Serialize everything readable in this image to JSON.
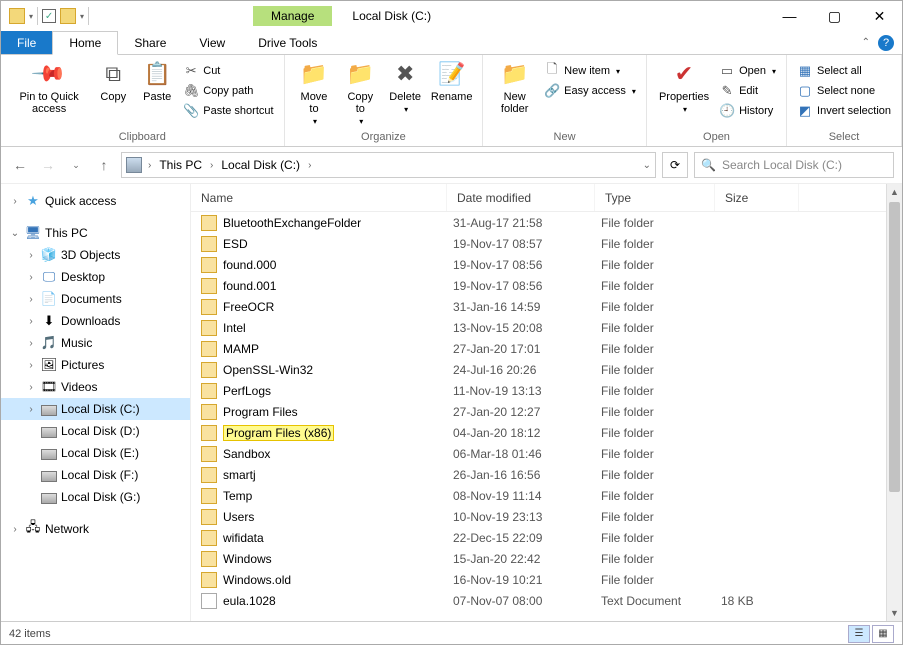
{
  "window": {
    "manage": "Manage",
    "title": "Local Disk (C:)"
  },
  "tabs": {
    "file": "File",
    "home": "Home",
    "share": "Share",
    "view": "View",
    "drive_tools": "Drive Tools"
  },
  "ribbon": {
    "pin": "Pin to Quick access",
    "copy": "Copy",
    "paste": "Paste",
    "cut": "Cut",
    "copy_path": "Copy path",
    "paste_shortcut": "Paste shortcut",
    "clipboard": "Clipboard",
    "move_to": "Move to",
    "copy_to": "Copy to",
    "delete": "Delete",
    "rename": "Rename",
    "organize": "Organize",
    "new_folder": "New folder",
    "new_item": "New item",
    "easy_access": "Easy access",
    "new": "New",
    "properties": "Properties",
    "open": "Open",
    "edit": "Edit",
    "history": "History",
    "open_group": "Open",
    "select_all": "Select all",
    "select_none": "Select none",
    "invert": "Invert selection",
    "select": "Select"
  },
  "address": {
    "this_pc": "This PC",
    "location": "Local Disk (C:)"
  },
  "search_placeholder": "Search Local Disk (C:)",
  "nav": {
    "quick_access": "Quick access",
    "this_pc": "This PC",
    "objects3d": "3D Objects",
    "desktop": "Desktop",
    "documents": "Documents",
    "downloads": "Downloads",
    "music": "Music",
    "pictures": "Pictures",
    "videos": "Videos",
    "disk_c": "Local Disk (C:)",
    "disk_d": "Local Disk (D:)",
    "disk_e": "Local Disk (E:)",
    "disk_f": "Local Disk (F:)",
    "disk_g": "Local Disk (G:)",
    "network": "Network"
  },
  "columns": {
    "name": "Name",
    "date": "Date modified",
    "type": "Type",
    "size": "Size"
  },
  "files": [
    {
      "name": "BluetoothExchangeFolder",
      "date": "31-Aug-17 21:58",
      "type": "File folder",
      "size": ""
    },
    {
      "name": "ESD",
      "date": "19-Nov-17 08:57",
      "type": "File folder",
      "size": ""
    },
    {
      "name": "found.000",
      "date": "19-Nov-17 08:56",
      "type": "File folder",
      "size": ""
    },
    {
      "name": "found.001",
      "date": "19-Nov-17 08:56",
      "type": "File folder",
      "size": ""
    },
    {
      "name": "FreeOCR",
      "date": "31-Jan-16 14:59",
      "type": "File folder",
      "size": ""
    },
    {
      "name": "Intel",
      "date": "13-Nov-15 20:08",
      "type": "File folder",
      "size": ""
    },
    {
      "name": "MAMP",
      "date": "27-Jan-20 17:01",
      "type": "File folder",
      "size": ""
    },
    {
      "name": "OpenSSL-Win32",
      "date": "24-Jul-16 20:26",
      "type": "File folder",
      "size": ""
    },
    {
      "name": "PerfLogs",
      "date": "11-Nov-19 13:13",
      "type": "File folder",
      "size": ""
    },
    {
      "name": "Program Files",
      "date": "27-Jan-20 12:27",
      "type": "File folder",
      "size": ""
    },
    {
      "name": "Program Files (x86)",
      "date": "04-Jan-20 18:12",
      "type": "File folder",
      "size": "",
      "highlight": true
    },
    {
      "name": "Sandbox",
      "date": "06-Mar-18 01:46",
      "type": "File folder",
      "size": ""
    },
    {
      "name": "smartj",
      "date": "26-Jan-16 16:56",
      "type": "File folder",
      "size": ""
    },
    {
      "name": "Temp",
      "date": "08-Nov-19 11:14",
      "type": "File folder",
      "size": ""
    },
    {
      "name": "Users",
      "date": "10-Nov-19 23:13",
      "type": "File folder",
      "size": ""
    },
    {
      "name": "wifidata",
      "date": "22-Dec-15 22:09",
      "type": "File folder",
      "size": ""
    },
    {
      "name": "Windows",
      "date": "15-Jan-20 22:42",
      "type": "File folder",
      "size": ""
    },
    {
      "name": "Windows.old",
      "date": "16-Nov-19 10:21",
      "type": "File folder",
      "size": ""
    },
    {
      "name": "eula.1028",
      "date": "07-Nov-07 08:00",
      "type": "Text Document",
      "size": "18 KB",
      "doc": true
    }
  ],
  "status": {
    "count": "42 items"
  }
}
